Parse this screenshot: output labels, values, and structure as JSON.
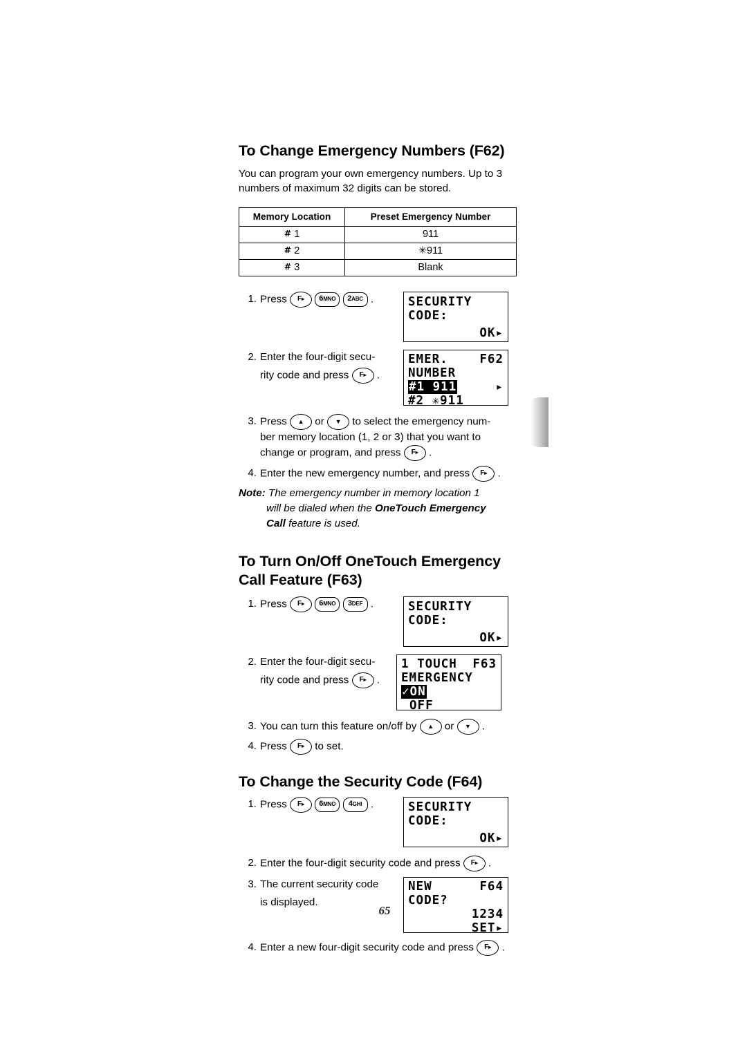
{
  "page": {
    "folio": "65"
  },
  "sections": [
    {
      "title": "To Change Emergency Numbers (F62)",
      "intro": "You can program your own emergency numbers. Up to 3 numbers of maximum 32 digits can be stored.",
      "table": {
        "headers": [
          "Memory Location",
          "Preset Emergency Number"
        ],
        "rows": [
          {
            "location_prefix": "#",
            "location": "1",
            "number": "911"
          },
          {
            "location_prefix": "#",
            "location": "2",
            "number": "✳911"
          },
          {
            "location_prefix": "#",
            "location": "3",
            "number": "Blank"
          }
        ]
      },
      "steps": [
        {
          "num": "1.",
          "text": "Press",
          "keys": [
            "F▸",
            "6 MNO",
            "2 ABC"
          ],
          "trailing": "."
        },
        {
          "num": "2.",
          "text": "Enter the four-digit secu-",
          "text2": "rity code and press",
          "keys": [
            "F▸"
          ],
          "trailing": "."
        },
        {
          "num": "3.",
          "text": "Press",
          "mid": "or",
          "text2": "to select the emergency num-",
          "text3": "ber memory location (1, 2 or 3) that you want to",
          "text4": "change or program, and press",
          "keys": [
            "▲",
            "▼",
            "F▸"
          ],
          "trailing": "."
        },
        {
          "num": "4.",
          "text": "Enter the new emergency number, and press",
          "keys": [
            "F▸"
          ],
          "trailing": "."
        }
      ],
      "note": {
        "label": "Note:",
        "line1": "The emergency number in memory location 1",
        "line2a": "will be dialed when the ",
        "line2b": "OneTouch Emergency",
        "line3a": "Call",
        "line3b": " feature is used."
      },
      "lcds": [
        {
          "id": "security-code-1",
          "line1": "SECURITY",
          "line2": "CODE:",
          "line3": "",
          "line4": "OK▸"
        },
        {
          "id": "emer-number",
          "left1": "EMER.",
          "right1": "F62",
          "line2": "NUMBER",
          "line3": "#1 911",
          "line3r": "▸",
          "line4": "#2 ✳911"
        }
      ]
    },
    {
      "title_line1": "To Turn On/Off OneTouch Emergency",
      "title_line2": "Call Feature (F63)",
      "steps": [
        {
          "num": "1.",
          "text": "Press",
          "keys": [
            "F▸",
            "6 MNO",
            "3 DEF"
          ],
          "trailing": "."
        },
        {
          "num": "2.",
          "text": "Enter the four-digit secu-",
          "text2": "rity code and press",
          "keys": [
            "F▸"
          ],
          "trailing": "."
        },
        {
          "num": "3.",
          "text": "You can turn this feature on/off by",
          "mid": "or",
          "keys": [
            "▲",
            "▼"
          ],
          "trailing": "."
        },
        {
          "num": "4.",
          "text": "Press",
          "text2": "to set.",
          "keys": [
            "F▸"
          ]
        }
      ],
      "lcds": [
        {
          "id": "security-code-2",
          "line1": "SECURITY",
          "line2": "CODE:",
          "line3": "",
          "line4": "OK▸"
        },
        {
          "id": "one-touch-emergency",
          "left1": "1 TOUCH",
          "right1": "F63",
          "line2": "EMERGENCY",
          "line3": "✓ON",
          "line4": "OFF"
        }
      ]
    },
    {
      "title": "To Change the Security Code (F64)",
      "steps": [
        {
          "num": "1.",
          "text": "Press",
          "keys": [
            "F▸",
            "6 MNO",
            "4 GHI"
          ],
          "trailing": "."
        },
        {
          "num": "2.",
          "text": "Enter the four-digit security code and press",
          "keys": [
            "F▸"
          ],
          "trailing": "."
        },
        {
          "num": "3.",
          "text": "The current security code",
          "text2": "is displayed."
        },
        {
          "num": "4.",
          "text": "Enter a new four-digit security code and press",
          "keys": [
            "F▸"
          ],
          "trailing": "."
        }
      ],
      "lcds": [
        {
          "id": "security-code-3",
          "line1": "SECURITY",
          "line2": "CODE:",
          "line3": "",
          "line4": "OK▸"
        },
        {
          "id": "new-code",
          "left1": "NEW",
          "right1": "F64",
          "line2": "CODE?",
          "line3": "1234",
          "line4": "SET▸"
        }
      ]
    }
  ],
  "keys": {
    "fn_letter": "F",
    "fn_arrow": "▸",
    "six": "6",
    "six_letters": "MNO",
    "two": "2",
    "two_letters": "ABC",
    "three": "3",
    "three_letters": "DEF",
    "four": "4",
    "four_letters": "GHI",
    "up": "▲",
    "down": "▼"
  }
}
